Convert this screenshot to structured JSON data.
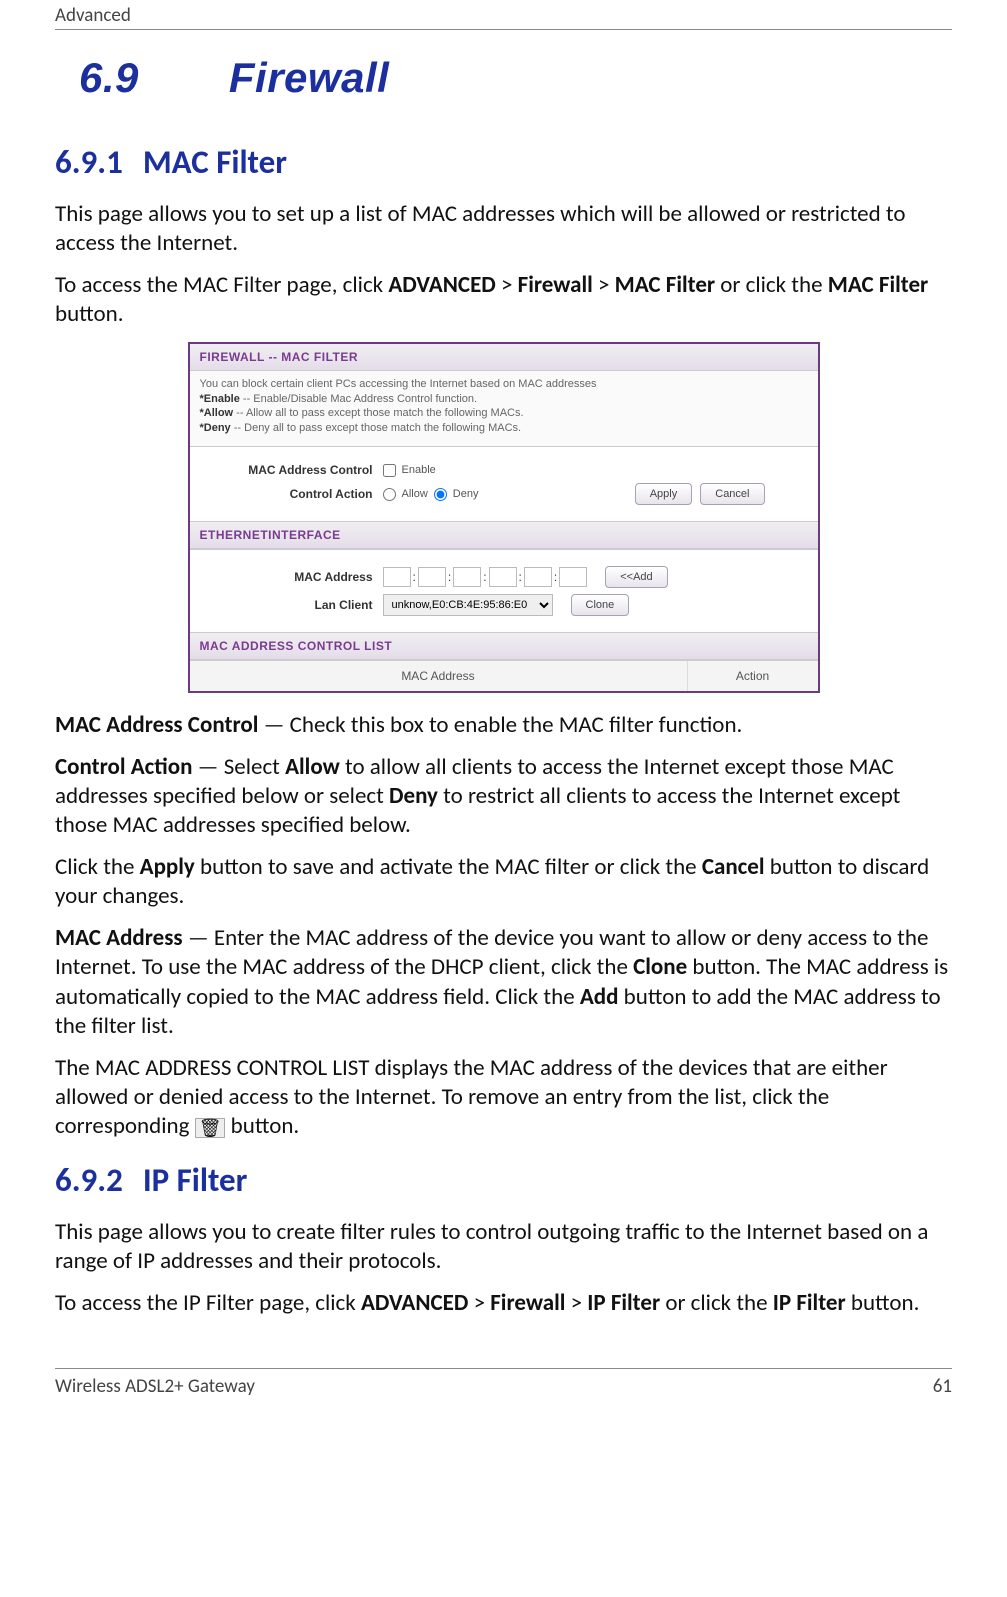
{
  "header": {
    "title": "Advanced"
  },
  "section": {
    "number": "6.9",
    "title": "Firewall"
  },
  "sub1": {
    "number": "6.9.1",
    "title": "MAC Filter",
    "intro": "This page allows you to set up a list of MAC addresses which will be allowed or restricted to access the Internet.",
    "nav_prefix": "To access the MAC Filter page, click ",
    "nav_advanced": "ADVANCED",
    "nav_sep": " > ",
    "nav_firewall": "Firewall",
    "nav_macfilter": "MAC Filter",
    "nav_mid": " or click the ",
    "nav_macfilter2": "MAC Filter",
    "nav_suffix": " button."
  },
  "screenshot": {
    "title1": "FIREWALL -- MAC FILTER",
    "desc_line1": "You can block certain client PCs accessing the Internet based on MAC addresses",
    "desc_enable_label": "*Enable",
    "desc_enable_text": " -- Enable/Disable Mac Address Control function.",
    "desc_allow_label": "*Allow",
    "desc_allow_text": " -- Allow all to pass except those match the following MACs.",
    "desc_deny_label": "*Deny",
    "desc_deny_text": " -- Deny all to pass except those match the following MACs.",
    "form": {
      "mac_control_label": "MAC Address Control",
      "enable_label": "Enable",
      "control_action_label": "Control Action",
      "allow_label": "Allow",
      "deny_label": "Deny",
      "apply_btn": "Apply",
      "cancel_btn": "Cancel"
    },
    "title2": "ETHERNETINTERFACE",
    "eth": {
      "mac_label": "MAC Address",
      "sep": ":",
      "add_btn": "<<Add",
      "lan_label": "Lan Client",
      "lan_value": "unknow,E0:CB:4E:95:86:E0",
      "clone_btn": "Clone"
    },
    "title3": "MAC ADDRESS CONTROL LIST",
    "table": {
      "col_mac": "MAC Address",
      "col_action": "Action"
    }
  },
  "body": {
    "p_mac_ctrl_label": "MAC Address Control",
    "p_mac_ctrl_text": " — Check this box to enable the MAC filter function.",
    "p_ctrl_action_label": "Control Action",
    "p_ctrl_action_pre": " — Select ",
    "p_allow": "Allow",
    "p_ctrl_action_mid1": " to allow all clients to access the Internet except those MAC addresses specified below or select ",
    "p_deny": "Deny",
    "p_ctrl_action_mid2": " to restrict all clients to access the Internet except those MAC addresses specified below.",
    "p_apply_pre": "Click the ",
    "p_apply": "Apply",
    "p_apply_mid": " button to save and activate the MAC filter or click the ",
    "p_cancel": "Cancel",
    "p_apply_post": " button to discard your changes.",
    "p_mac_addr_label": "MAC Address",
    "p_mac_addr_pre": " — Enter the MAC address of the device you want to allow or deny access to the Internet. To use the MAC address of the DHCP client, click the ",
    "p_clone": "Clone",
    "p_mac_addr_mid": " button. The MAC address is automatically copied to the MAC address field. Click the ",
    "p_add": "Add",
    "p_mac_addr_post": " button to add the MAC address to the filter list.",
    "p_list_pre": "The MAC ADDRESS CONTROL LIST displays the MAC address of the devices that are either allowed or denied access to the Internet. To remove an entry from the list, click the corresponding ",
    "p_list_post": " button."
  },
  "sub2": {
    "number": "6.9.2",
    "title": "IP Filter",
    "intro": "This page allows you to create filter rules to control outgoing traffic to the Internet based on a range of IP addresses and their protocols.",
    "nav_prefix": "To access the IP Filter page, click ",
    "nav_advanced": "ADVANCED",
    "nav_sep": " > ",
    "nav_firewall": "Firewall",
    "nav_ipfilter": "IP Filter",
    "nav_mid": " or click the ",
    "nav_ipfilter2": "IP Filter",
    "nav_suffix": " button."
  },
  "footer": {
    "left": "Wireless ADSL2+ Gateway",
    "right": "61"
  },
  "icons": {
    "trash": "🗑"
  }
}
